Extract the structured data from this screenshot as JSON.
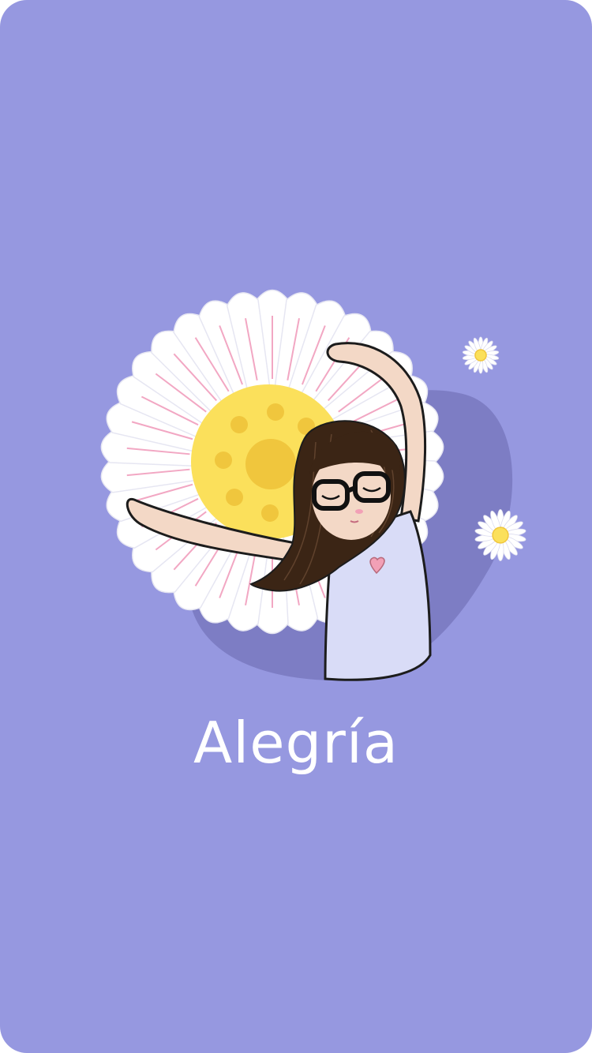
{
  "screen": {
    "title": "Alegría",
    "background_color": "#9698e0"
  },
  "illustration": {
    "subject": "girl-with-glasses-dancing",
    "icons": [
      "large-daisy-icon",
      "small-daisy-icon",
      "heart-icon"
    ],
    "colors": {
      "shadow_blob": "#7d7dc4",
      "petal": "#ffffff",
      "petal_line": "#f2a7c3",
      "flower_center": "#fbe05b",
      "flower_center_dots": "#f0c63d",
      "hair": "#3b2515",
      "skin": "#f3d8c6",
      "shirt": "#d9dcf7",
      "heart": "#f2a0b6"
    }
  }
}
